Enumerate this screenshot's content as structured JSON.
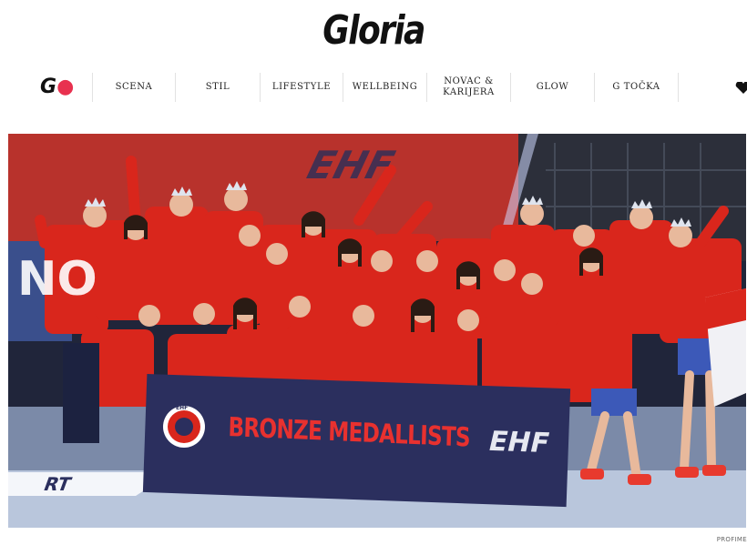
{
  "header": {
    "logo": "Gloria"
  },
  "nav": {
    "mark": "G",
    "items": [
      {
        "label": "SCENA"
      },
      {
        "label": "STIL"
      },
      {
        "label": "LIFESTYLE"
      },
      {
        "label": "WELLBEING"
      },
      {
        "label": "NOVAC &\nKARIJERA"
      },
      {
        "label": "GLOW"
      },
      {
        "label": "G TOČKA"
      }
    ],
    "heart_icon": "heart-icon"
  },
  "hero": {
    "banner_text": "BRONZE MEDALLISTS",
    "banner_logo": "EHF",
    "banner_emblem": "EHF",
    "wall_text": "EHF",
    "court_text": "RT",
    "side_text": "NO",
    "colors": {
      "banner": "#2b2f5e",
      "banner_text": "#e8312f",
      "jersey": "#d9261c"
    }
  },
  "credit": "PROFIME"
}
